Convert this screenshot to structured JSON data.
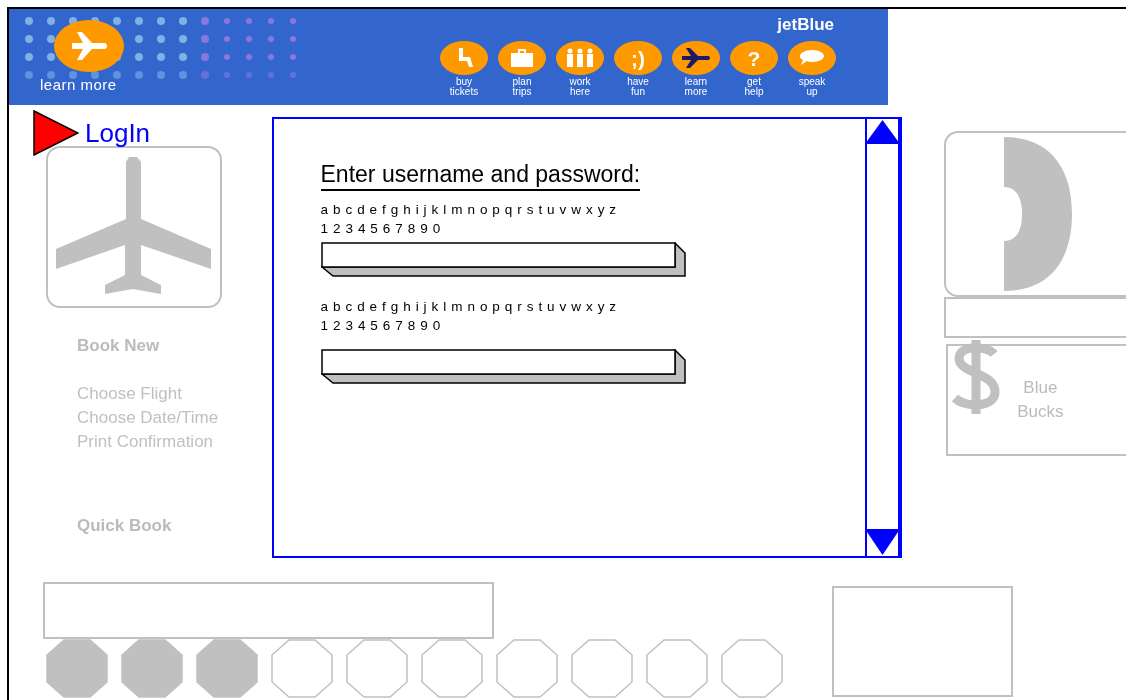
{
  "header": {
    "promo": {
      "label": "learn more"
    },
    "brand": "jetBlue",
    "nav": [
      {
        "kind": "seat",
        "label": "buy tickets"
      },
      {
        "kind": "briefcase",
        "label": "plan trips"
      },
      {
        "kind": "people",
        "label": "work here"
      },
      {
        "kind": "glyph",
        "glyph": ";)",
        "label": "have fun"
      },
      {
        "kind": "plane",
        "label": "learn more"
      },
      {
        "kind": "glyph",
        "glyph": "?",
        "label": "get help"
      },
      {
        "kind": "speech",
        "label": "speak up"
      }
    ]
  },
  "sidebar": {
    "heading": "LogIn",
    "groups": [
      {
        "title": "Book New",
        "items": [
          "Choose Flight",
          "Choose Date/Time",
          "Print Confirmation"
        ]
      },
      {
        "title": "Quick Book"
      }
    ]
  },
  "login": {
    "title": "Enter username and password:",
    "fields": [
      {
        "hint": [
          "a b c d e f g h i j k l m n o p q r s t u v w x y z",
          "1 2 3 4 5 6 7 8 9 0"
        ]
      },
      {
        "hint": [
          "a b c d e f g h i j k l m n o p q r s t u v w x y z",
          "1 2 3 4 5 6 7 8 9 0"
        ]
      }
    ]
  },
  "right_panel": {
    "rewards": {
      "label": "Blue Bucks"
    }
  },
  "progress": [
    {
      "filled": true
    },
    {
      "filled": true
    },
    {
      "filled": true
    },
    {
      "filled": false
    },
    {
      "filled": false
    },
    {
      "filled": false
    },
    {
      "filled": false
    },
    {
      "filled": false
    },
    {
      "filled": false
    },
    {
      "filled": false
    }
  ]
}
